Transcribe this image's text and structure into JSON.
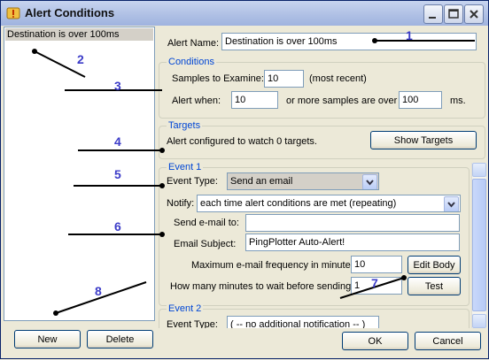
{
  "window": {
    "title": "Alert Conditions"
  },
  "left_list": {
    "items": [
      "Destination is over 100ms"
    ]
  },
  "buttons": {
    "new": "New",
    "delete": "Delete",
    "ok": "OK",
    "cancel": "Cancel",
    "show_targets": "Show Targets",
    "edit_body": "Edit Body",
    "test": "Test"
  },
  "alert_name": {
    "label": "Alert Name:",
    "value": "Destination is over 100ms"
  },
  "conditions": {
    "title": "Conditions",
    "samples_label": "Samples to Examine:",
    "samples_value": "10",
    "samples_suffix": "(most recent)",
    "alert_when_label": "Alert when:",
    "alert_when_value": "10",
    "mid_label": "or more samples are over",
    "threshold_value": "100",
    "unit": "ms."
  },
  "targets": {
    "title": "Targets",
    "text": "Alert configured to watch 0 targets."
  },
  "event1": {
    "title": "Event 1",
    "type_label": "Event Type:",
    "type_value": "Send an email",
    "notify_label": "Notify:",
    "notify_value": "each time alert conditions are met (repeating)",
    "send_to_label": "Send e-mail to:",
    "send_to_value": "",
    "subject_label": "Email Subject:",
    "subject_value": "PingPlotter Auto-Alert!",
    "freq_label": "Maximum e-mail frequency in minutes:",
    "freq_value": "10",
    "wait_label": "How many minutes to wait before sending:",
    "wait_value": "1"
  },
  "event2": {
    "title": "Event 2",
    "type_label": "Event Type:",
    "type_value": "( -- no additional notification -- )"
  },
  "annotations": [
    "1",
    "2",
    "3",
    "4",
    "5",
    "6",
    "7",
    "8"
  ],
  "icons": [
    "alert-window-icon",
    "minimize-icon",
    "maximize-icon",
    "close-icon",
    "dropdown-arrow-icon"
  ]
}
